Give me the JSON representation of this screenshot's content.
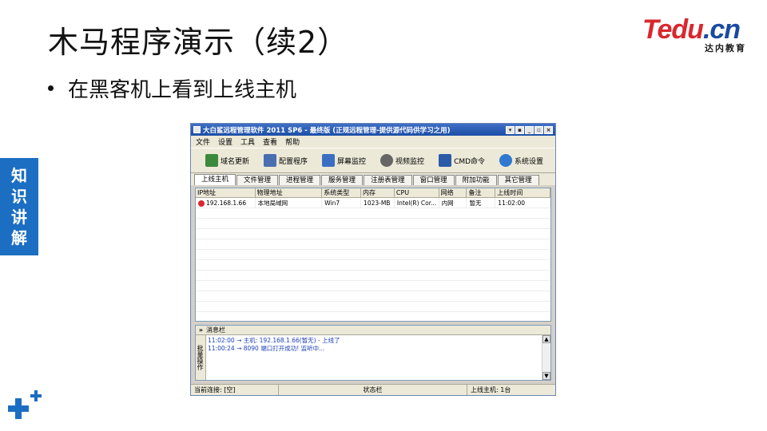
{
  "slide": {
    "title": "木马程序演示（续2）",
    "bullet": "在黑客机上看到上线主机",
    "side_tab": [
      "知",
      "识",
      "讲",
      "解"
    ],
    "logo_main_a": "Tedu",
    "logo_main_b": ".cn",
    "logo_sub": "达内教育"
  },
  "window": {
    "title": "大白鲨远程管理软件 2011 SP6 - 最终版 (正规远程管理-提供源代码供学习之用)",
    "titlebar_buttons": [
      "▾",
      "▪",
      "_",
      "▫",
      "×"
    ],
    "menu": [
      "文件",
      "设置",
      "工具",
      "查看",
      "帮助"
    ],
    "toolbar": [
      {
        "label": "域名更新",
        "icon": "globe-refresh-icon",
        "color": "#3c8a3c"
      },
      {
        "label": "配置程序",
        "icon": "config-icon",
        "color": "#4a6fb0"
      },
      {
        "label": "屏幕监控",
        "icon": "monitor-icon",
        "color": "#3b6fc1"
      },
      {
        "label": "视频监控",
        "icon": "webcam-icon",
        "color": "#666666"
      },
      {
        "label": "CMD命令",
        "icon": "cmd-icon",
        "color": "#2b5aa8"
      },
      {
        "label": "系统设置",
        "icon": "settings-icon",
        "color": "#2f7ad0"
      }
    ],
    "tabs": [
      "上线主机",
      "文件管理",
      "进程管理",
      "服务管理",
      "注册表管理",
      "窗口管理",
      "附加功能",
      "其它管理"
    ],
    "grid": {
      "columns": [
        "IP地址",
        "物理地址",
        "系统类型",
        "内存",
        "CPU",
        "网络",
        "备注",
        "上线时间"
      ],
      "rows": [
        [
          "192.168.1.66",
          "本地局域网",
          "Win7",
          "1023-MB",
          "Intel(R) Cor...",
          "内网",
          "暂无",
          "11:02:00"
        ]
      ]
    },
    "messages": {
      "header_chevron": "»",
      "header": "消息栏",
      "side_label": "批量操作",
      "lines": [
        "11:02:00 → 主机: 192.168.1.66(暂无) - 上线了",
        "11:00:24 → 8090 端口打开成功! 监听中..."
      ],
      "scroll_up": "▲",
      "scroll_down": "▼"
    },
    "status": {
      "current": "当前连接: [空]",
      "middle": "状态栏",
      "online": "上线主机: 1台"
    }
  }
}
